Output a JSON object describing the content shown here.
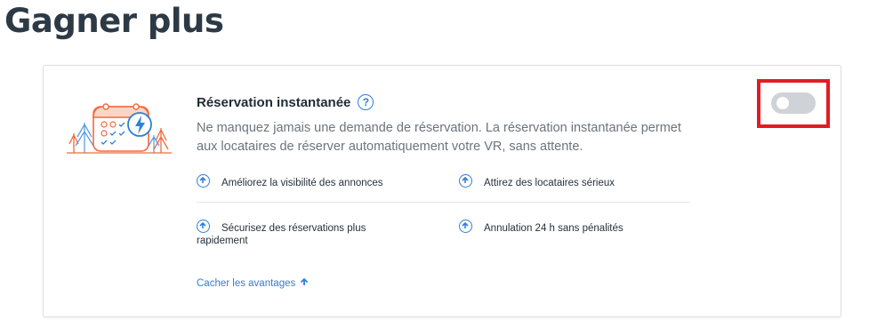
{
  "page": {
    "title": "Gagner plus"
  },
  "feature": {
    "title": "Réservation instantanée",
    "help_icon": "question-circle-icon",
    "description": "Ne manquez jamais une demande de réservation. La réservation instantanée permet aux locataires de réserver automatiquement votre VR, sans attente.",
    "illustration_icon": "calendar-lightning-icon",
    "enabled": false,
    "benefits": [
      {
        "icon": "arrow-up-circle-icon",
        "label": "Améliorez la visibilité des annonces"
      },
      {
        "icon": "arrow-up-circle-icon",
        "label": "Attirez des locataires sérieux"
      },
      {
        "icon": "arrow-up-circle-icon",
        "label": "Sécurisez des réservations plus rapidement"
      },
      {
        "icon": "arrow-up-circle-icon",
        "label": "Annulation 24 h sans pénalités"
      }
    ],
    "hide_benefits_label": "Cacher les avantages"
  },
  "colors": {
    "accent": "#2f7fd8",
    "highlight": "#e31c23",
    "toggle_off": "#cfd2d6",
    "illustration_orange": "#f26a3d"
  }
}
